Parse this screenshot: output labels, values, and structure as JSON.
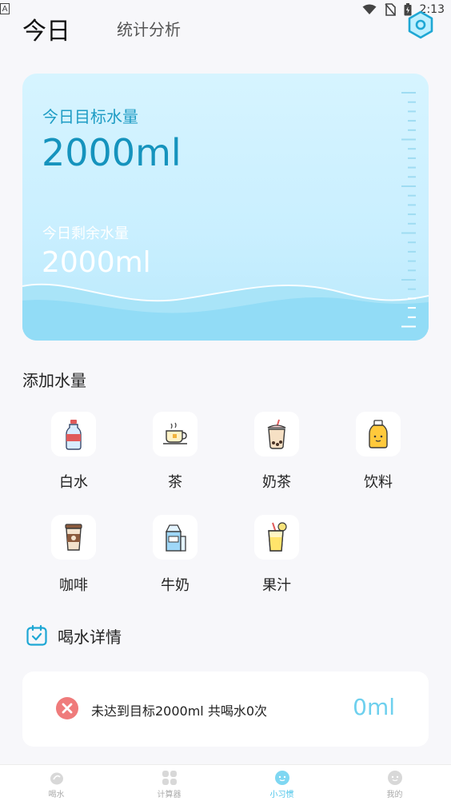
{
  "status_bar": {
    "time": "2:13",
    "left_badge": "A"
  },
  "header": {
    "tabs": [
      {
        "label": "今日",
        "active": true
      },
      {
        "label": "统计分析",
        "active": false
      }
    ],
    "settings_icon": "hexagon-settings-icon"
  },
  "water_card": {
    "goal_label": "今日目标水量",
    "goal_value": "2000ml",
    "remaining_label": "今日剩余水量",
    "remaining_value": "2000ml"
  },
  "add_water": {
    "title": "添加水量",
    "items": [
      {
        "label": "白水",
        "icon": "water-bottle-icon"
      },
      {
        "label": "茶",
        "icon": "tea-cup-icon"
      },
      {
        "label": "奶茶",
        "icon": "milk-tea-icon"
      },
      {
        "label": "饮料",
        "icon": "juice-bottle-icon"
      },
      {
        "label": "咖啡",
        "icon": "coffee-cup-icon"
      },
      {
        "label": "牛奶",
        "icon": "milk-carton-icon"
      },
      {
        "label": "果汁",
        "icon": "fruit-juice-icon"
      }
    ]
  },
  "details": {
    "title": "喝水详情",
    "summary_text": "未达到目标2000ml 共喝水0次",
    "total": "0ml"
  },
  "bottom_nav": [
    {
      "label": "喝水",
      "active": false
    },
    {
      "label": "计算器",
      "active": false
    },
    {
      "label": "小习惯",
      "active": true
    },
    {
      "label": "我的",
      "active": false
    }
  ],
  "colors": {
    "accent": "#4cc5ea",
    "card_bg": "#d6f4ff",
    "goal_text": "#1593bd",
    "fail_red": "#ef7b7b"
  }
}
